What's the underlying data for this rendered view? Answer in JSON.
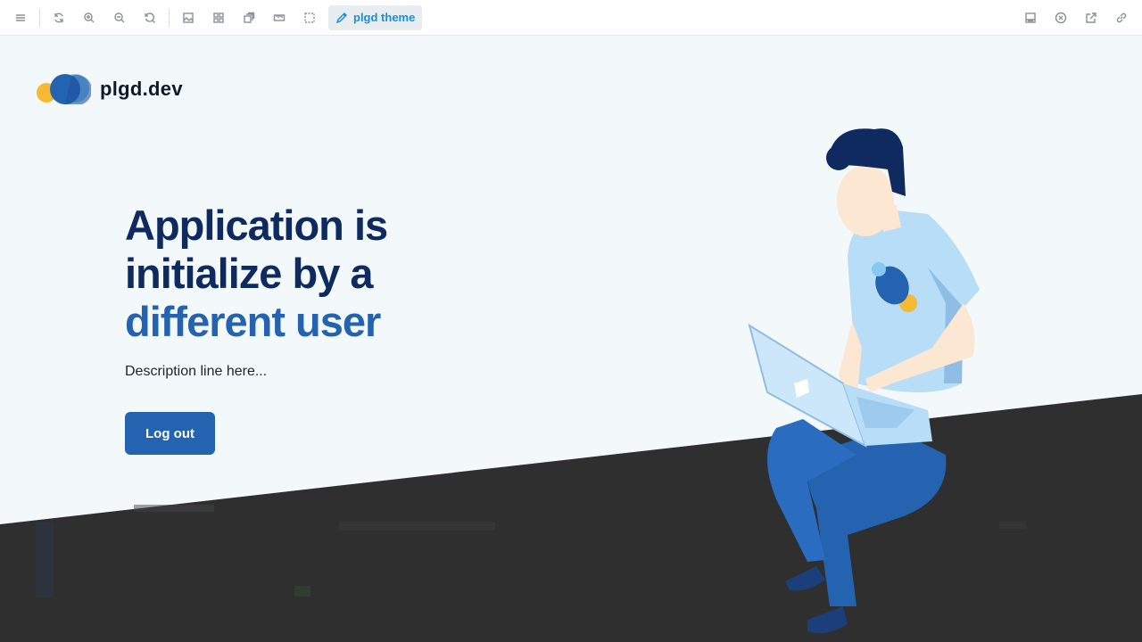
{
  "toolbar": {
    "left_icons": [
      "menu-icon",
      "refresh-icon",
      "zoom-in-icon",
      "zoom-out-icon",
      "zoom-reset-icon",
      "image-icon",
      "grid-icon",
      "layers-icon",
      "ruler-icon",
      "selection-icon"
    ],
    "theme_button_label": "plgd theme",
    "right_icons": [
      "panel-icon",
      "close-circle-icon",
      "external-link-icon",
      "link-icon"
    ]
  },
  "brand": {
    "name": "plgd.dev"
  },
  "hero": {
    "title_line1": "Application is",
    "title_line2": "initialize by a",
    "title_accent": "different user",
    "description": "Description line here...",
    "button_label": "Log out"
  },
  "colors": {
    "primary": "#2463b0",
    "heading": "#0e2a5e",
    "background": "#f3f8fb",
    "dark_overlay": "#2f2f2f",
    "toolbar_accent": "#1a90d6"
  }
}
